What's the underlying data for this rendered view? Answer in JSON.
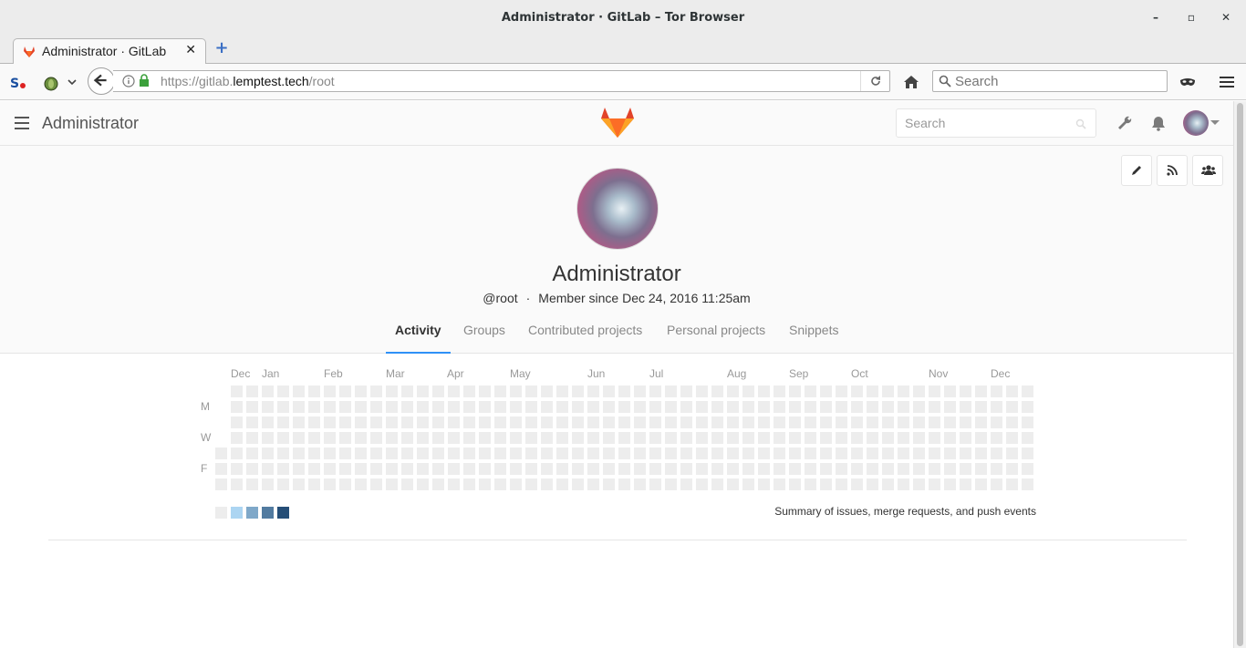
{
  "window": {
    "title": "Administrator · GitLab – Tor Browser"
  },
  "browser": {
    "tab_title": "Administrator · GitLab",
    "url_prefix": "https://gitlab.",
    "url_domain": "lemptest.tech",
    "url_path": "/root",
    "search_placeholder": "Search"
  },
  "gitlab": {
    "header_title": "Administrator",
    "search_placeholder": "Search"
  },
  "profile": {
    "name": "Administrator",
    "username": "@root",
    "separator": "·",
    "member_since": "Member since Dec 24, 2016 11:25am",
    "tabs": [
      {
        "label": "Activity"
      },
      {
        "label": "Groups"
      },
      {
        "label": "Contributed projects"
      },
      {
        "label": "Personal projects"
      },
      {
        "label": "Snippets"
      }
    ]
  },
  "calendar": {
    "months": [
      "Dec",
      "Jan",
      "Feb",
      "Mar",
      "Apr",
      "May",
      "Jun",
      "Jul",
      "Aug",
      "Sep",
      "Oct",
      "Nov",
      "Dec"
    ],
    "days": [
      "M",
      "W",
      "F"
    ],
    "summary": "Summary of issues, merge requests, and push events",
    "legend_colors": [
      "#ededed",
      "#acd5f2",
      "#7fa8c9",
      "#527ba0",
      "#254e77"
    ],
    "empty_color": "#ededed"
  },
  "colors": {
    "accent": "#2e91f7",
    "gitlab_orange": "#e24329"
  }
}
